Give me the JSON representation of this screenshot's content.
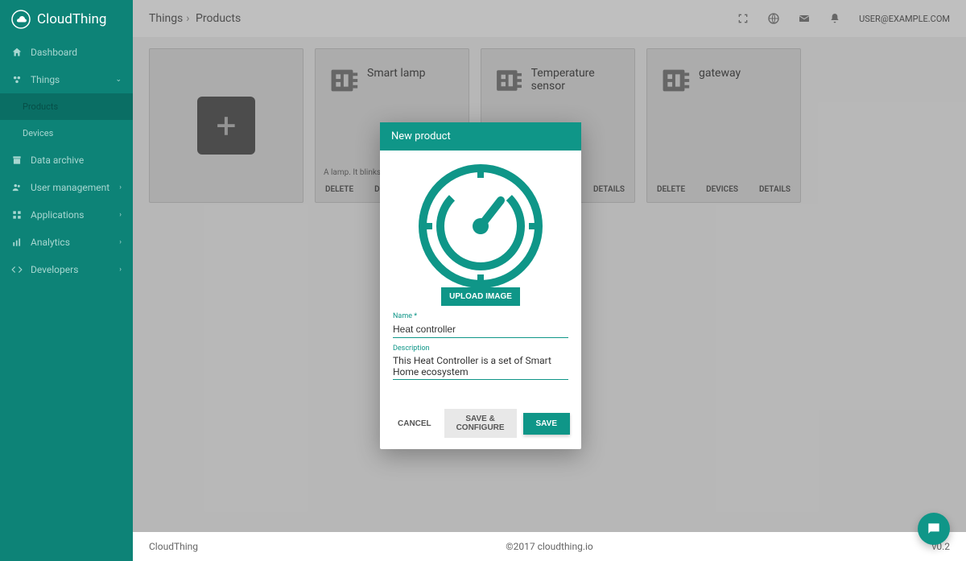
{
  "brand": "CloudThing",
  "sidebar": {
    "items": [
      {
        "label": "Dashboard"
      },
      {
        "label": "Things",
        "expanded": true
      },
      {
        "label": "Products",
        "sub": true,
        "active": true
      },
      {
        "label": "Devices",
        "sub": true
      },
      {
        "label": "Data archive"
      },
      {
        "label": "User management"
      },
      {
        "label": "Applications"
      },
      {
        "label": "Analytics"
      },
      {
        "label": "Developers"
      }
    ]
  },
  "breadcrumb": {
    "parent": "Things",
    "current": "Products"
  },
  "user": "USER@EXAMPLE.COM",
  "products": [
    {
      "title": "Smart lamp",
      "desc": "A lamp. It blinks on other stuff!"
    },
    {
      "title": "Temperature sensor",
      "desc": ""
    },
    {
      "title": "gateway",
      "desc": ""
    }
  ],
  "card_actions": {
    "delete": "DELETE",
    "devices": "DEVICES",
    "details": "DETAILS"
  },
  "modal": {
    "title": "New product",
    "upload_label": "UPLOAD IMAGE",
    "name_label": "Name *",
    "name_value": "Heat controller",
    "desc_label": "Description",
    "desc_value": "This Heat Controller is a set of Smart Home ecosystem",
    "cancel": "CANCEL",
    "save_configure": "SAVE & CONFIGURE",
    "save": "SAVE"
  },
  "footer": {
    "left": "CloudThing",
    "center": "©2017 cloudthing.io",
    "right": "v0.2"
  }
}
